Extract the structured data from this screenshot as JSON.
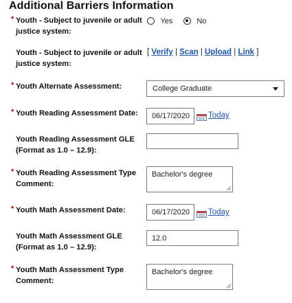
{
  "section_title": "Additional Barriers Information",
  "required_marker": "*",
  "juvenile": {
    "label": "Youth - Subject to juvenile or adult justice system:",
    "yes_label": "Yes",
    "no_label": "No",
    "selected": "No"
  },
  "juvenile_docs": {
    "label": "Youth - Subject to juvenile or adult justice system:",
    "open_bracket": "[",
    "close_bracket": "]",
    "separator": "|",
    "verify": "Verify",
    "scan": "Scan",
    "upload": "Upload",
    "link": "Link"
  },
  "alternate_assessment": {
    "label": "Youth Alternate Assessment:",
    "value": "College Graduate"
  },
  "reading_date": {
    "label": "Youth Reading Assessment Date:",
    "value": "06/17/2020",
    "today": "Today"
  },
  "reading_gle": {
    "label": "Youth Reading Assessment GLE (Format as 1.0 – 12.9):",
    "value": ""
  },
  "reading_comment": {
    "label": "Youth Reading Assessment Type Comment:",
    "value": "Bachelor's degree"
  },
  "math_date": {
    "label": "Youth Math Assessment Date:",
    "value": "06/17/2020",
    "today": "Today"
  },
  "math_gle": {
    "label": "Youth Math Assessment GLE (Format as 1.0 – 12.9):",
    "value": "12.0"
  },
  "math_comment": {
    "label": "Youth Math Assessment Type Comment:",
    "value": "Bachelor's degree"
  },
  "icons": {
    "calendar": "calendar-icon",
    "dropdown": "chevron-down-icon",
    "resize": "resize-grip-icon"
  }
}
